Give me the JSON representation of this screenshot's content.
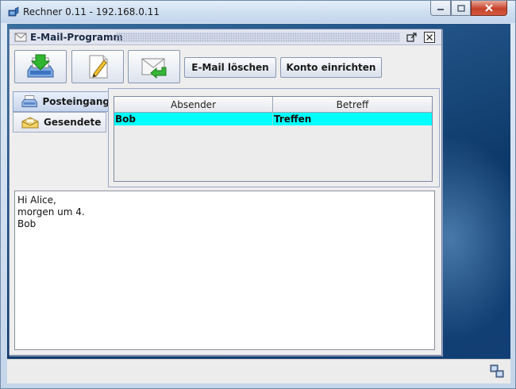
{
  "window": {
    "title": "Rechner 0.11 - 192.168.0.11",
    "controls": {
      "minimize": "minimize-icon",
      "maximize": "maximize-icon",
      "close": "close-icon"
    }
  },
  "mail_frame": {
    "title": "E-Mail-Programm",
    "icon": "envelope-icon"
  },
  "toolbar": {
    "fetch_icon": "download-inbox-icon",
    "compose_icon": "pencil-paper-icon",
    "reply_icon": "envelope-reply-arrow-icon",
    "delete_label": "E-Mail löschen",
    "account_label": "Konto einrichten"
  },
  "tabs": [
    {
      "label": "Posteingang",
      "icon": "inbox-tray-icon",
      "selected": true
    },
    {
      "label": "Gesendete",
      "icon": "sent-envelope-icon",
      "selected": false
    }
  ],
  "table": {
    "columns": [
      "Absender",
      "Betreff"
    ],
    "rows": [
      {
        "sender": "Bob",
        "subject": "Treffen",
        "selected": true
      }
    ]
  },
  "message": {
    "body": "Hi Alice,\nmorgen um 4.\nBob"
  },
  "statusbar": {
    "icon": "network-icon"
  },
  "colors": {
    "selection": "#00ffff",
    "desktop": "#1f4f83",
    "close_button": "#c7422b"
  }
}
